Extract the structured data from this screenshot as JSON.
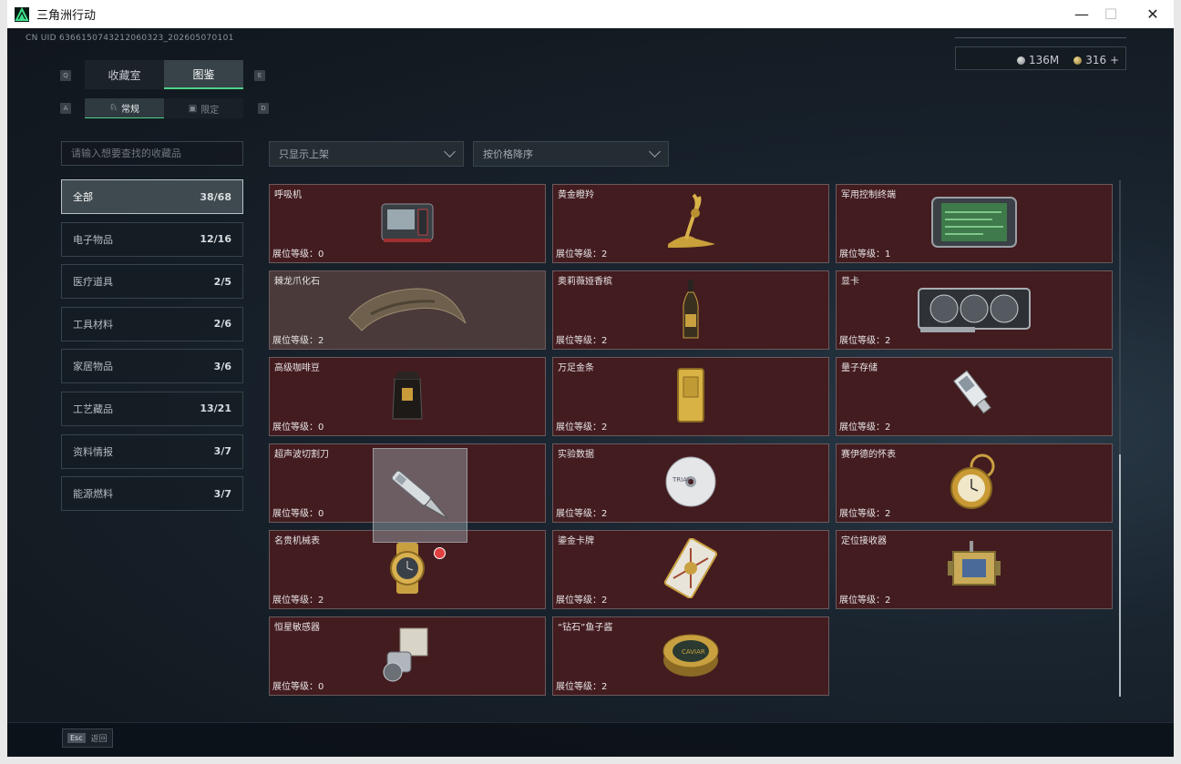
{
  "window": {
    "title": "三角洲行动"
  },
  "header": {
    "uid": "CN UID 6366150743212060323_202605070101",
    "currency_silver": "136M",
    "currency_gold": "316 +"
  },
  "tabs": {
    "key_left": "Q",
    "key_right": "E",
    "items": [
      "收藏室",
      "图鉴"
    ],
    "active": 1
  },
  "subtabs": {
    "key_left": "A",
    "key_right": "D",
    "items": [
      "常规",
      "限定"
    ],
    "active": 0
  },
  "search": {
    "placeholder": "请输入想要查找的收藏品"
  },
  "filters": {
    "shelf": "只显示上架",
    "sort": "按价格降序"
  },
  "categories": [
    {
      "label": "全部",
      "count": "38/68",
      "active": true
    },
    {
      "label": "电子物品",
      "count": "12/16"
    },
    {
      "label": "医疗道具",
      "count": "2/5"
    },
    {
      "label": "工具材料",
      "count": "2/6"
    },
    {
      "label": "家居物品",
      "count": "3/6"
    },
    {
      "label": "工艺藏品",
      "count": "13/21"
    },
    {
      "label": "资料情报",
      "count": "3/7"
    },
    {
      "label": "能源燃料",
      "count": "3/7"
    }
  ],
  "items": [
    {
      "name": "呼吸机",
      "level": "展位等级：0",
      "icon": "ventilator-icon"
    },
    {
      "name": "黄金瞪羚",
      "level": "展位等级：2",
      "icon": "gold-gazelle-icon"
    },
    {
      "name": "军用控制终端",
      "level": "展位等级：1",
      "icon": "military-terminal-icon"
    },
    {
      "name": "棘龙爪化石",
      "level": "展位等级：2",
      "icon": "claw-fossil-icon"
    },
    {
      "name": "奥莉薇娅香槟",
      "level": "展位等级：2",
      "icon": "champagne-icon"
    },
    {
      "name": "显卡",
      "level": "展位等级：2",
      "icon": "graphics-card-icon"
    },
    {
      "name": "高级咖啡豆",
      "level": "展位等级：0",
      "icon": "coffee-beans-icon"
    },
    {
      "name": "万足金条",
      "level": "展位等级：2",
      "icon": "gold-bar-icon"
    },
    {
      "name": "量子存储",
      "level": "展位等级：2",
      "icon": "quantum-storage-icon"
    },
    {
      "name": "超声波切割刀",
      "level": "展位等级：0",
      "icon": "ultrasonic-knife-icon"
    },
    {
      "name": "实验数据",
      "level": "展位等级：2",
      "icon": "disc-icon"
    },
    {
      "name": "赛伊德的怀表",
      "level": "展位等级：2",
      "icon": "pocket-watch-icon"
    },
    {
      "name": "名贵机械表",
      "level": "展位等级：2",
      "icon": "watch-icon"
    },
    {
      "name": "鎏金卡牌",
      "level": "展位等级：2",
      "icon": "gilded-card-icon"
    },
    {
      "name": "定位接收器",
      "level": "展位等级：2",
      "icon": "locator-receiver-icon"
    },
    {
      "name": "恒星敏感器",
      "level": "展位等级：0",
      "icon": "star-sensor-icon"
    },
    {
      "name": "“钻石”鱼子酱",
      "level": "展位等级：2",
      "icon": "caviar-tin-icon"
    }
  ],
  "footer": {
    "esc_key": "Esc",
    "esc_label": "返回"
  }
}
